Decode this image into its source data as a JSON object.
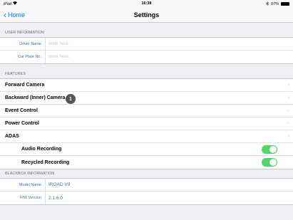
{
  "status_bar": {
    "device": "iPad",
    "wifi_icon": "wifi-icon",
    "time": "16:38",
    "bluetooth_icon": "bluetooth-icon",
    "battery": "97%"
  },
  "nav": {
    "back_label": "Home",
    "title": "Settings",
    "accent": "#007aff"
  },
  "user_info": {
    "header": "USER INFORMATION",
    "fields": [
      {
        "label": "Driver Name",
        "placeholder": "Write here."
      },
      {
        "label": "Car Plate No.",
        "placeholder": "Write here."
      }
    ]
  },
  "features": {
    "header": "FEATURES",
    "badge": "1",
    "items": [
      {
        "label": "Forward Camera"
      },
      {
        "label": "Backward (Inner) Camera"
      },
      {
        "label": "Event Control"
      },
      {
        "label": "Power Control"
      },
      {
        "label": "ADAS"
      },
      {
        "label": "Audio Recording",
        "toggle": true
      },
      {
        "label": "Recycled Recording",
        "toggle": true
      }
    ],
    "toggle_color": "#4cd964"
  },
  "blackbox": {
    "header": "BLACKBOX INFORMATION",
    "fields": [
      {
        "label": "Model Name",
        "value": "IROAD V9"
      },
      {
        "label": "F/W Version",
        "value": "2.1.6.0"
      }
    ]
  }
}
